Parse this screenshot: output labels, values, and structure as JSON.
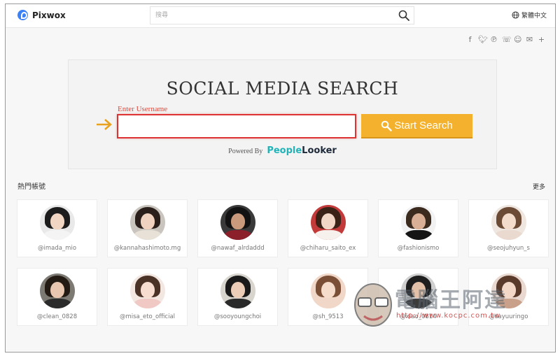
{
  "header": {
    "logo_text": "Pixwox",
    "search_placeholder": "搜尋",
    "language_label": "繁體中文"
  },
  "share_icons": [
    "facebook-icon",
    "twitter-icon",
    "pinterest-icon",
    "whatsapp-icon",
    "reddit-icon",
    "messenger-icon",
    "plus-icon"
  ],
  "search_panel": {
    "title": "SOCIAL MEDIA SEARCH",
    "input_label": "Enter Username",
    "input_value": "",
    "button_label": "Start Search",
    "powered_by_label": "Powered By",
    "brand_part1": "People",
    "brand_part2": "Looker"
  },
  "hot_accounts": {
    "title": "熱門帳號",
    "more_label": "更多",
    "accounts": [
      {
        "handle": "@imada_mio"
      },
      {
        "handle": "@kannahashimoto.mg"
      },
      {
        "handle": "@nawaf_alrdaddd"
      },
      {
        "handle": "@chiharu_saito_ex"
      },
      {
        "handle": "@fashionismo"
      },
      {
        "handle": "@seojuhyun_s"
      },
      {
        "handle": "@clean_0828"
      },
      {
        "handle": "@misa_eto_official"
      },
      {
        "handle": "@sooyoungchoi"
      },
      {
        "handle": "@sh_9513"
      },
      {
        "handle": "@xiao_0814"
      },
      {
        "handle": "@sayuuringo"
      }
    ]
  },
  "watermark": {
    "text": "電腦王阿達",
    "url": "http://www.kocpc.com.tw"
  },
  "colors": {
    "accent": "#f4b12e",
    "input_border": "#dd3333",
    "brand_teal": "#20b4b8"
  }
}
